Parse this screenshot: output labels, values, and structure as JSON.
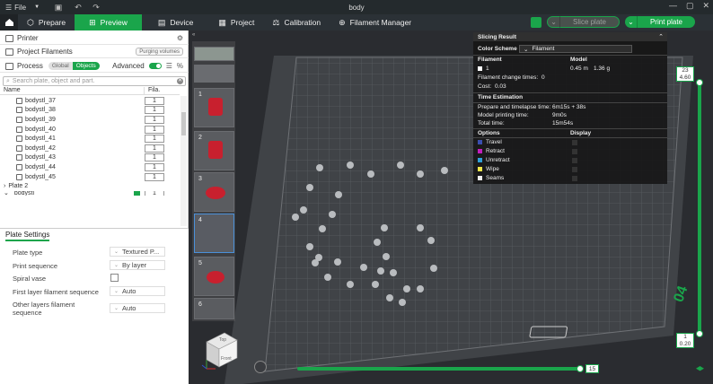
{
  "titlebar": {
    "file_label": "File",
    "title": "body"
  },
  "nav": {
    "tabs": [
      {
        "label": "Prepare",
        "icon": "prepare-icon",
        "active": false
      },
      {
        "label": "Preview",
        "icon": "preview-icon",
        "active": true
      },
      {
        "label": "Device",
        "icon": "device-icon",
        "active": false
      },
      {
        "label": "Project",
        "icon": "project-icon",
        "active": false
      },
      {
        "label": "Calibration",
        "icon": "calibration-icon",
        "active": false
      },
      {
        "label": "Filament Manager",
        "icon": "filament-manager-icon",
        "active": false
      }
    ],
    "slice_label": "Slice plate",
    "print_label": "Print plate",
    "accent": "#1aa54b"
  },
  "left": {
    "printer_label": "Printer",
    "project_filaments_label": "Project Filaments",
    "purging_volumes_label": "Purging volumes",
    "process_label": "Process",
    "global_label": "Global",
    "objects_label": "Objects",
    "advanced_label": "Advanced",
    "advanced_on": true,
    "search_placeholder": "Search plate, object and part.",
    "col_name": "Name",
    "col_fila": "Fila.",
    "objects": [
      {
        "name": "bodystl_37",
        "fila": "1"
      },
      {
        "name": "bodystl_38",
        "fila": "1"
      },
      {
        "name": "bodystl_39",
        "fila": "1"
      },
      {
        "name": "bodystl_40",
        "fila": "1"
      },
      {
        "name": "bodystl_41",
        "fila": "1"
      },
      {
        "name": "bodystl_42",
        "fila": "1"
      },
      {
        "name": "bodystl_43",
        "fila": "1"
      },
      {
        "name": "bodystl_44",
        "fila": "1"
      },
      {
        "name": "bodystl_45",
        "fila": "1"
      }
    ],
    "plate2_label": "Plate 2",
    "plate2_obj": "bodystl",
    "plate2_fila": "1"
  },
  "plate_settings": {
    "header": "Plate Settings",
    "rows": [
      {
        "label": "Plate type",
        "value": "Textured P..."
      },
      {
        "label": "Print sequence",
        "value": "By layer"
      },
      {
        "label": "Spiral vase",
        "value": ""
      },
      {
        "label": "First layer filament sequence",
        "value": "Auto"
      },
      {
        "label": "Other layers filament",
        "label2": "sequence",
        "value": "Auto"
      }
    ]
  },
  "thumbs": [
    "1",
    "2",
    "3",
    "4",
    "5",
    "6"
  ],
  "slicing": {
    "title": "Slicing Result",
    "color_scheme_label": "Color Scheme",
    "color_scheme_value": "Filament",
    "col_filament": "Filament",
    "col_model": "Model",
    "filament_id": "1",
    "model_length": "0.45 m",
    "model_weight": "1.36 g",
    "filament_change": "Filament change times:",
    "filament_change_val": "0",
    "cost_label": "Cost:",
    "cost_val": "0.03",
    "time_est": "Time Estimation",
    "prepare_label": "Prepare and timelapse time:",
    "prepare_val": "6m15s + 38s",
    "model_time_label": "Model printing time:",
    "model_time_val": "9m0s",
    "total_label": "Total time:",
    "total_val": "15m54s",
    "options_label": "Options",
    "display_label": "Display",
    "options": [
      {
        "label": "Travel",
        "color": "#3a4fb0"
      },
      {
        "label": "Retract",
        "color": "#c21fbd"
      },
      {
        "label": "Unretract",
        "color": "#2fa0d8"
      },
      {
        "label": "Wipe",
        "color": "#f2e84a"
      },
      {
        "label": "Seams",
        "color": "#eeeeee"
      }
    ]
  },
  "layer_slider": {
    "top_layer": "23",
    "top_height": "4.60",
    "bottom_layer": "1",
    "bottom_height": "0.20"
  },
  "move_slider": {
    "value": "15"
  },
  "cube": {
    "top": "Top",
    "front": "Front"
  },
  "plate_label": "04"
}
